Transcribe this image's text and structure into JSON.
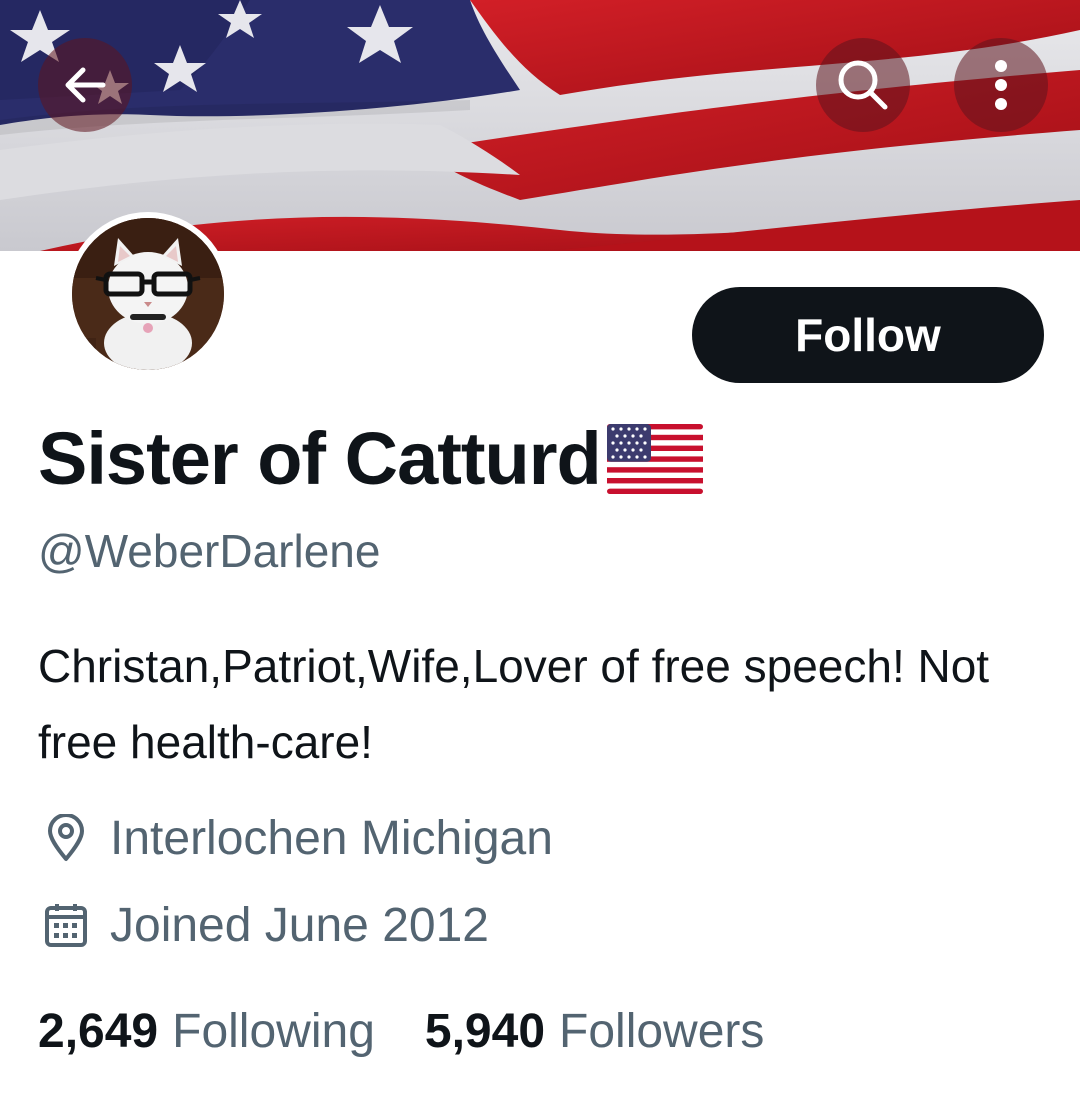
{
  "header": {
    "back_icon": "arrow-left-icon",
    "search_icon": "search-icon",
    "more_icon": "more-vertical-icon"
  },
  "colors": {
    "banner_red": "#c4161c",
    "banner_blue": "#2a2d6b",
    "follow_button_bg": "#0f1419",
    "secondary_text": "#536471"
  },
  "profile": {
    "display_name": "Sister of Catturd",
    "display_name_emoji": "us-flag-emoji",
    "handle": "@WeberDarlene",
    "follow_label": "Follow",
    "bio": "Christan,Patriot,Wife,Lover of free speech! Not free health-care!",
    "location": "Interlochen Michigan",
    "location_icon": "location-pin-icon",
    "joined": "Joined June 2012",
    "joined_icon": "calendar-icon"
  },
  "stats": {
    "following_count": "2,649",
    "following_label": "Following",
    "followers_count": "5,940",
    "followers_label": "Followers"
  }
}
